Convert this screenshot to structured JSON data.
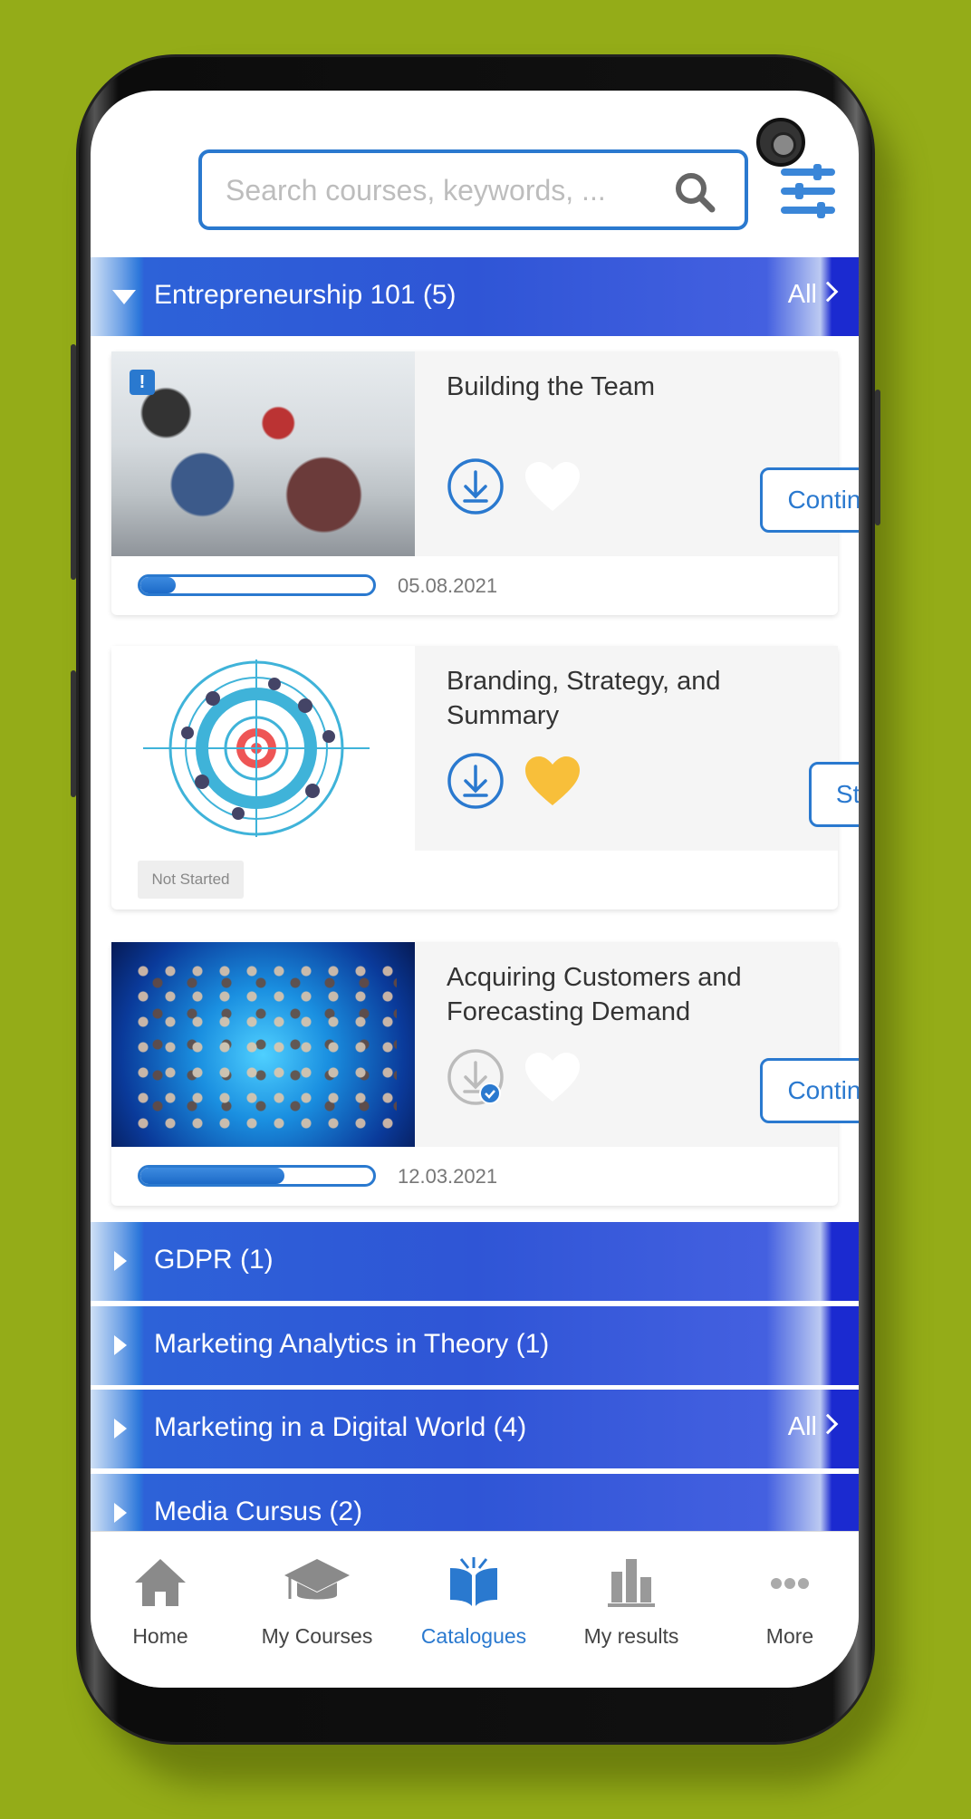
{
  "search": {
    "placeholder": "Search courses, keywords, ..."
  },
  "colors": {
    "accent": "#2a79cf",
    "heart_active": "#f8bf3a",
    "background": "#94ac18"
  },
  "categories": [
    {
      "name": "Entrepreneurship 101 (5)",
      "expanded": true,
      "all_label": "All"
    },
    {
      "name": "GDPR (1)",
      "expanded": false
    },
    {
      "name": "Marketing Analytics in Theory (1)",
      "expanded": false
    },
    {
      "name": "Marketing in a Digital World (4)",
      "expanded": false,
      "all_label": "All"
    },
    {
      "name": "Media Cursus (2)",
      "expanded": false
    }
  ],
  "courses": [
    {
      "title": "Building the Team",
      "action": "Continue",
      "progress_percent": 15,
      "date": "05.08.2021",
      "favorite": false,
      "downloaded": false,
      "alert_badge": "!"
    },
    {
      "title": "Branding, Strategy, and Summary",
      "action": "Start",
      "status": "Not Started",
      "favorite": true,
      "downloaded": false
    },
    {
      "title": "Acquiring Customers and Forecasting Demand",
      "action": "Continue",
      "progress_percent": 62,
      "date": "12.03.2021",
      "favorite": false,
      "downloaded": true
    }
  ],
  "nav": [
    {
      "label": "Home",
      "icon": "home-icon"
    },
    {
      "label": "My Courses",
      "icon": "graduation-cap-icon"
    },
    {
      "label": "Catalogues",
      "icon": "book-icon",
      "active": true
    },
    {
      "label": "My results",
      "icon": "bar-chart-icon"
    },
    {
      "label": "More",
      "icon": "more-icon"
    }
  ]
}
